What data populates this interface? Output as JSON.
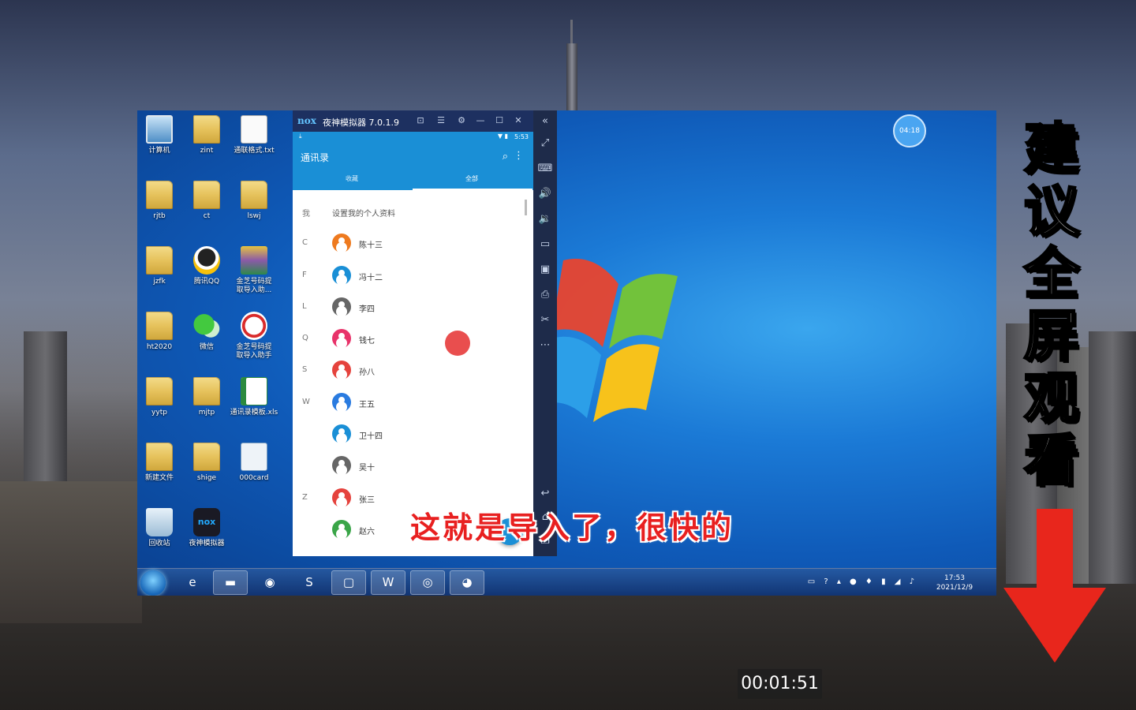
{
  "emulator": {
    "brand": "nox",
    "title": "夜神模拟器 7.0.1.9",
    "statusbar_time": "5:53"
  },
  "contacts_app": {
    "title": "通讯录",
    "tabs": [
      "收藏",
      "全部"
    ],
    "active_tab": "全部",
    "me_label": "我",
    "me_text": "设置我的个人资料",
    "contacts": [
      {
        "letter": "C",
        "name": "陈十三",
        "color": "#ee7a1f"
      },
      {
        "letter": "F",
        "name": "冯十二",
        "color": "#1a8fd6"
      },
      {
        "letter": "L",
        "name": "李四",
        "color": "#666666"
      },
      {
        "letter": "Q",
        "name": "钱七",
        "color": "#e8336a"
      },
      {
        "letter": "S",
        "name": "孙八",
        "color": "#e5433d"
      },
      {
        "letter": "W",
        "name": "王五",
        "color": "#2a7be0"
      },
      {
        "letter": "",
        "name": "卫十四",
        "color": "#1a8fd6"
      },
      {
        "letter": "",
        "name": "吴十",
        "color": "#666666"
      },
      {
        "letter": "Z",
        "name": "张三",
        "color": "#e5433d"
      },
      {
        "letter": "",
        "name": "赵六",
        "color": "#3aa548"
      }
    ]
  },
  "desktop_icons": [
    {
      "label": "计算机",
      "icon": "computer-icon"
    },
    {
      "label": "zint",
      "icon": "folder-icon"
    },
    {
      "label": "通联格式.txt",
      "icon": "text-file-icon"
    },
    {
      "label": "rjtb",
      "icon": "folder-icon"
    },
    {
      "label": "ct",
      "icon": "folder-icon"
    },
    {
      "label": "lswj",
      "icon": "folder-icon"
    },
    {
      "label": "jzfk",
      "icon": "folder-icon"
    },
    {
      "label": "腾讯QQ",
      "icon": "qq-icon"
    },
    {
      "label": "金芝号码提\n取导入助...",
      "icon": "rar-icon"
    },
    {
      "label": "ht2020",
      "icon": "folder-icon"
    },
    {
      "label": "微信",
      "icon": "wechat-icon"
    },
    {
      "label": "金芝号码提\n取导入助手",
      "icon": "seal-icon"
    },
    {
      "label": "yytp",
      "icon": "folder-icon"
    },
    {
      "label": "mjtp",
      "icon": "folder-icon"
    },
    {
      "label": "通讯录模板.xls",
      "icon": "spreadsheet-icon"
    },
    {
      "label": "新建文件",
      "icon": "folder-icon"
    },
    {
      "label": "shige",
      "icon": "folder-icon"
    },
    {
      "label": "000card",
      "icon": "vcard-icon"
    },
    {
      "label": "回收站",
      "icon": "recycle-bin-icon"
    },
    {
      "label": "夜神模拟器",
      "icon": "nox-icon"
    }
  ],
  "desktop_badge": "04:18",
  "taskbar": {
    "time": "17:53",
    "date": "2021/12/9"
  },
  "subtitle": "这就是导入了，很快的",
  "side_banner": "建议全屏观看",
  "video_timer": "00:01:51"
}
